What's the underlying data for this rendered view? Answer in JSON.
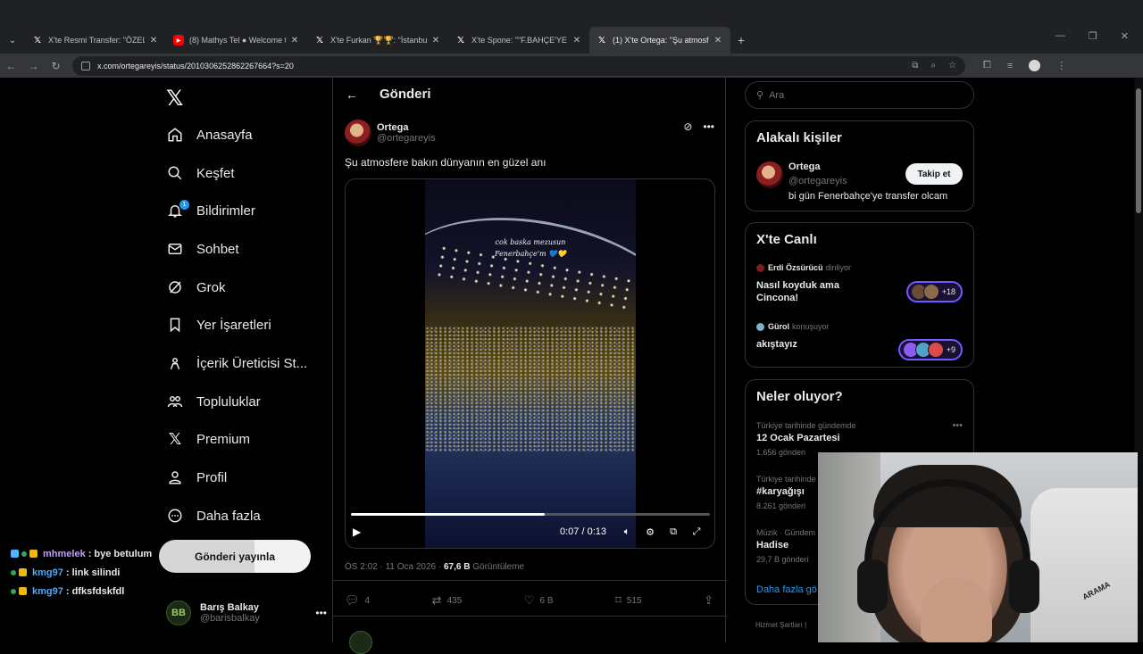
{
  "browser": {
    "tabs": [
      {
        "title": "X'te Resmi Transfer: \"ÖZEL| Fen",
        "favicon": "x-icon",
        "active": false
      },
      {
        "title": "(8) Mathys Tel ● Welcome to G",
        "favicon": "youtube-icon",
        "active": false
      },
      {
        "title": "X'te Furkan 🏆🏆: \"İstanbul'da",
        "favicon": "x-icon",
        "active": false
      },
      {
        "title": "X'te Spone: \"\"F.BAHÇE'YE GELM",
        "favicon": "x-icon",
        "active": false
      },
      {
        "title": "(1) X'te Ortega: \"Şu atmosfere b",
        "favicon": "x-icon",
        "active": true
      }
    ],
    "url": "x.com/ortegareyis/status/2010306252862267664?s=20"
  },
  "nav": {
    "items": [
      {
        "label": "Anasayfa",
        "icon": "home-icon"
      },
      {
        "label": "Keşfet",
        "icon": "search-icon"
      },
      {
        "label": "Bildirimler",
        "icon": "bell-icon",
        "badge": "1"
      },
      {
        "label": "Sohbet",
        "icon": "mail-icon"
      },
      {
        "label": "Grok",
        "icon": "grok-icon"
      },
      {
        "label": "Yer İşaretleri",
        "icon": "bookmark-icon"
      },
      {
        "label": "İçerik Üreticisi St...",
        "icon": "creator-icon"
      },
      {
        "label": "Topluluklar",
        "icon": "communities-icon"
      },
      {
        "label": "Premium",
        "icon": "x-icon"
      },
      {
        "label": "Profil",
        "icon": "person-icon"
      },
      {
        "label": "Daha fazla",
        "icon": "more-circle-icon"
      }
    ],
    "post_button": "Gönderi yayınla",
    "account": {
      "name": "Barış Balkay",
      "handle": "@barisbalkay",
      "avatar_text": "BB"
    }
  },
  "chat": [
    {
      "user": "mhmelek",
      "message": ": bye betulum",
      "color": "#c89bff"
    },
    {
      "user": "kmg97",
      "message": ": link silindi",
      "color": "#4aa8ff"
    },
    {
      "user": "kmg97",
      "message": ": dfksfdskfdl",
      "color": "#4aa8ff"
    }
  ],
  "main": {
    "header": "Gönderi",
    "author": {
      "name": "Ortega",
      "handle": "@ortegareyis"
    },
    "text": "Şu atmosfere bakın dünyanın en güzel anı",
    "video": {
      "caption_line1": "cok baska mezusun",
      "caption_line2": "Fenerbahçe'm 💙💛",
      "time": "0:07 / 0:13",
      "progress": 0.54
    },
    "meta": {
      "time": "ÖS 2:02 · 11 Oca 2026 · ",
      "views": "67,6 B",
      "views_label": " Görüntüleme"
    },
    "actions": {
      "replies": "4",
      "reposts": "435",
      "likes": "6 B",
      "bookmarks": "515"
    }
  },
  "right": {
    "search_placeholder": "Ara",
    "related": {
      "heading": "Alakalı kişiler",
      "name": "Ortega",
      "handle": "@ortegareyis",
      "bio": "bi gün Fenerbahçe'ye transfer olcam",
      "follow": "Takip et"
    },
    "live": {
      "heading": "X'te Canlı",
      "spaces": [
        {
          "host": "Erdi Özsürücü",
          "status": "dinliyor",
          "title": "Nasıl koyduk ama Cincona!",
          "count": "+18"
        },
        {
          "host": "Gürol",
          "status": "konuşuyor",
          "title": "akıştayız",
          "count": "+9"
        }
      ]
    },
    "trends": {
      "heading": "Neler oluyor?",
      "items": [
        {
          "context": "Türkiye tarihinde gündemde",
          "title": "12 Ocak Pazartesi",
          "count": "1.656 gönderi"
        },
        {
          "context": "Türkiye tarihinde",
          "title": "#karyağışı",
          "count": "8.261 gönderi"
        },
        {
          "context": "Müzik · Gündem",
          "title": "Hadise",
          "count": "29,7 B gönderi"
        }
      ],
      "show_more": "Daha fazla gö"
    },
    "footer": "Hizmet Şartları  |"
  },
  "webcam": {
    "chair_label": "ARAMA"
  }
}
